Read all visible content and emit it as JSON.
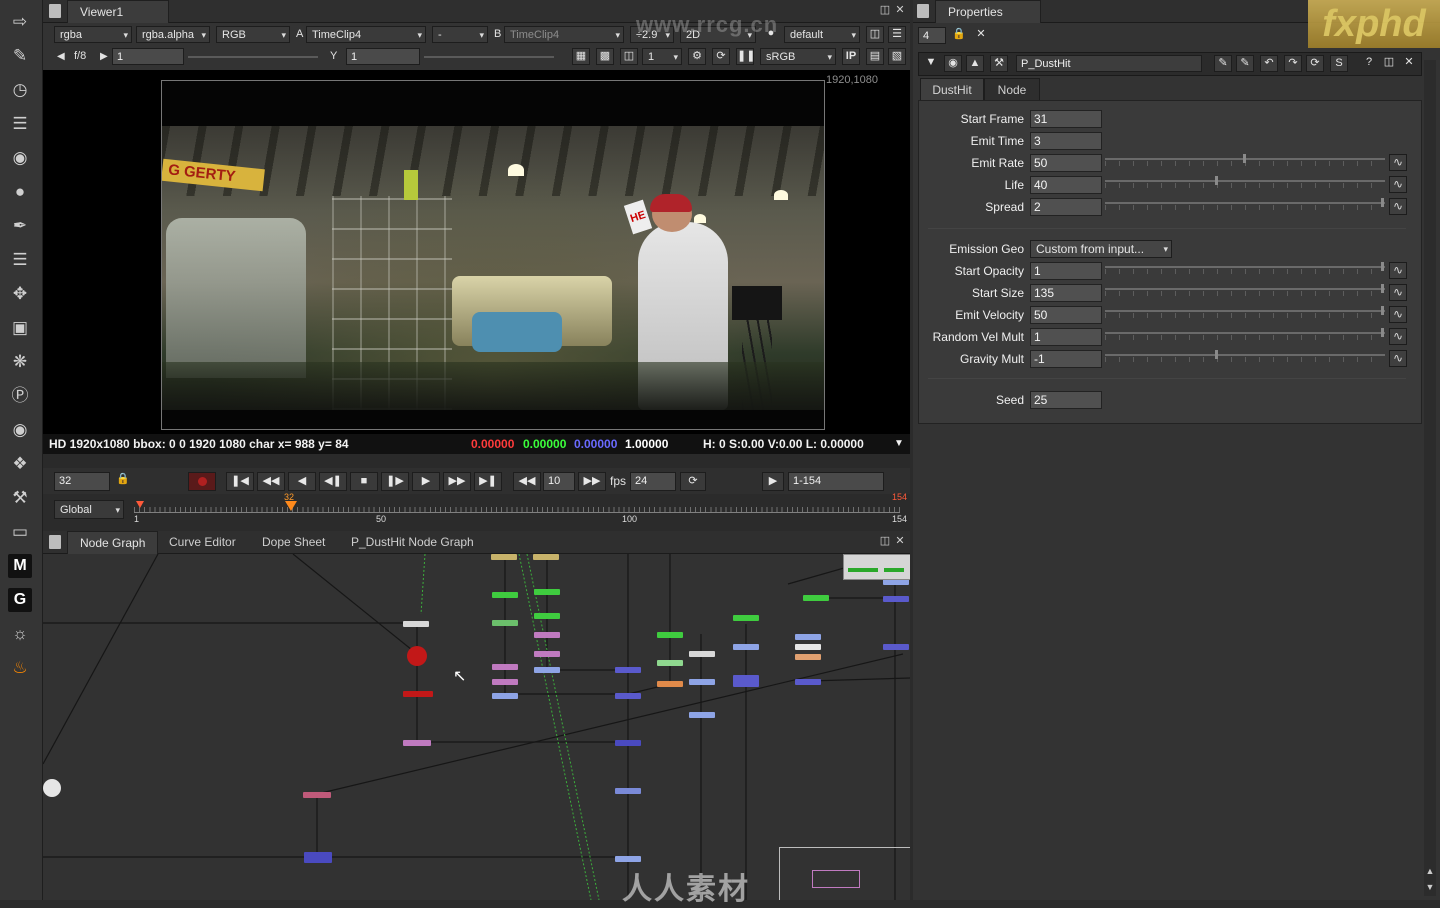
{
  "toolbar": {
    "icons": [
      "image-icon",
      "draw-icon",
      "time-icon",
      "channel-icon",
      "color-icon",
      "filter-icon",
      "keyer-icon",
      "merge-icon",
      "transform-icon",
      "3d-icon",
      "particles-icon",
      "deep-icon",
      "views-icon",
      "metadata-icon",
      "toolsets-icon",
      "other-icon",
      "m-icon",
      "g-icon",
      "plugin-icon",
      "fire-icon"
    ],
    "m_label": "M",
    "g_label": "G"
  },
  "viewer": {
    "tab_title": "Viewer1",
    "channel_set": "rgba",
    "alpha_channel": "rgba.alpha",
    "display_channels": "RGB",
    "input_a_label": "A",
    "input_a": "TimeClip4",
    "compare_mode": "-",
    "input_b_label": "B",
    "input_b": "TimeClip4",
    "gain": "÷2.9",
    "view_mode": "2D",
    "lut_default": "default",
    "fstop": "f/8",
    "gain_value": "1",
    "gamma_label": "Y",
    "gamma_value": "1",
    "proxy_value": "1",
    "colorspace": "sRGB",
    "ip_label": "IP",
    "resolution_label": "1920,1080",
    "poster_text": "G GERTY",
    "sign_text": "HE",
    "info": {
      "format": "HD 1920x1080 bbox: 0 0 1920 1080 char  x= 988 y=  84",
      "r": "0.00000",
      "g": "0.00000",
      "b": "0.00000",
      "a": "1.00000",
      "hsv": "H:   0 S:0.00 V:0.00  L: 0.00000"
    },
    "colors": {
      "r": "#ff3b3b",
      "g": "#3bff3b",
      "b": "#5a5aff"
    }
  },
  "timeline": {
    "current_frame": "32",
    "increment": "10",
    "fps_label": "fps",
    "fps": "24",
    "range": "1-154",
    "mode": "Global",
    "ticks": [
      "1",
      "50",
      "100",
      "154"
    ],
    "marker_current": "32",
    "marker_end": "154"
  },
  "nodegraph": {
    "tabs": [
      "Node Graph",
      "Curve Editor",
      "Dope Sheet",
      "P_DustHit Node Graph"
    ]
  },
  "properties": {
    "title": "Properties",
    "max_panels": "4",
    "node_name": "P_DustHit",
    "tabs": [
      "DustHit",
      "Node"
    ],
    "params": [
      {
        "label": "Start Frame",
        "value": "31"
      },
      {
        "label": "Emit Time",
        "value": "3"
      },
      {
        "label": "Emit Rate",
        "value": "50"
      },
      {
        "label": "Life",
        "value": "40"
      },
      {
        "label": "Spread",
        "value": "2"
      },
      {
        "label": "Emission Geo",
        "value": "Custom from input..."
      },
      {
        "label": "Start Opacity",
        "value": "1"
      },
      {
        "label": "Start Size",
        "value": "135"
      },
      {
        "label": "Emit Velocity",
        "value": "50"
      },
      {
        "label": "Random Vel Mult",
        "value": "1"
      },
      {
        "label": "Gravity Mult",
        "value": "-1"
      },
      {
        "label": "Seed",
        "value": "25"
      }
    ]
  },
  "branding": {
    "logo": "fxphd",
    "site": "www.rrcg.cn",
    "bottom_watermark": "人人素材"
  }
}
